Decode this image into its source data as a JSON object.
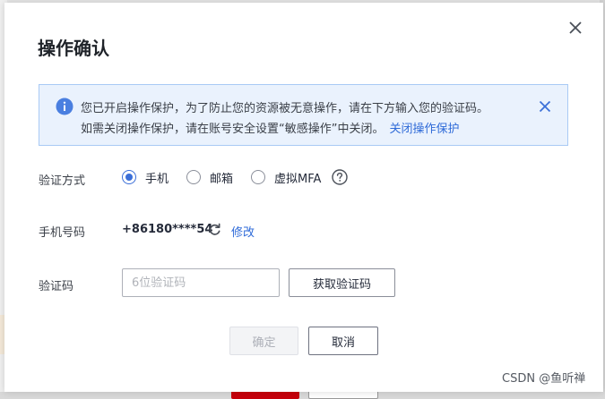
{
  "dialog": {
    "title": "操作确认",
    "alert": {
      "line1": "您已开启操作保护，为了防止您的资源被无意操作，请在下方输入您的验证码。",
      "line2": "如需关闭操作保护，请在账号安全设置“敏感操作”中关闭。",
      "link": "关闭操作保护"
    },
    "verify_method": {
      "label": "验证方式",
      "options": [
        "手机",
        "邮箱",
        "虚拟MFA"
      ],
      "selected": "手机"
    },
    "phone": {
      "label": "手机号码",
      "value": "+86180****54",
      "edit_link": "修改"
    },
    "code": {
      "label": "验证码",
      "placeholder": "6位验证码",
      "value": "",
      "get_code_label": "获取验证码"
    },
    "buttons": {
      "confirm": "确定",
      "cancel": "取消"
    }
  },
  "watermark": "CSDN @鱼听禅",
  "colors": {
    "accent": "#3b6fd8",
    "link": "#2e6ad8",
    "alert_bg": "#eaf2fd",
    "alert_border": "#a9caf5",
    "info_icon": "#4a7fe0"
  },
  "icons": [
    "close-icon",
    "info-icon",
    "alert-close-icon",
    "help-icon",
    "refresh-icon"
  ]
}
